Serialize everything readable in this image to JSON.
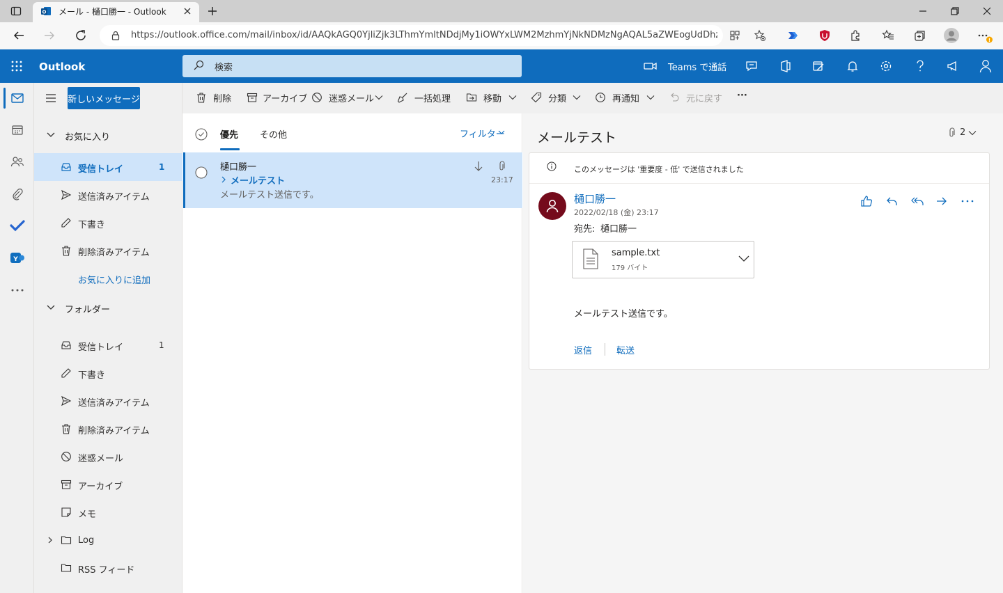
{
  "browser": {
    "tab_title": "メール - 樋口勝一 - Outlook",
    "url": "https://outlook.office.com/mail/inbox/id/AAQkAGQ0YjliZjk3LThmYmltNDdjMy1iOWYxLWM2MzhmYjNkNDMzNgAQAL5aZWEogUdDhz..."
  },
  "suite": {
    "app_name": "Outlook",
    "search_placeholder": "検索",
    "teams_call": "Teams で通話"
  },
  "new_message": "新しいメッセージ",
  "toolbar": {
    "delete": "削除",
    "archive": "アーカイブ",
    "junk": "迷惑メール",
    "sweep": "一括処理",
    "move": "移動",
    "categorize": "分類",
    "snooze": "再通知",
    "undo": "元に戻す",
    "more": "···"
  },
  "nav": {
    "favorites_header": "お気に入り",
    "favorites": [
      {
        "label": "受信トレイ",
        "count": "1"
      },
      {
        "label": "送信済みアイテム",
        "count": ""
      },
      {
        "label": "下書き",
        "count": ""
      },
      {
        "label": "削除済みアイテム",
        "count": ""
      }
    ],
    "add_favorite": "お気に入りに追加",
    "folders_header": "フォルダー",
    "folders": [
      {
        "label": "受信トレイ",
        "count": "1"
      },
      {
        "label": "下書き",
        "count": ""
      },
      {
        "label": "送信済みアイテム",
        "count": ""
      },
      {
        "label": "削除済みアイテム",
        "count": ""
      },
      {
        "label": "迷惑メール",
        "count": ""
      },
      {
        "label": "アーカイブ",
        "count": ""
      },
      {
        "label": "メモ",
        "count": ""
      },
      {
        "label": "Log",
        "count": ""
      },
      {
        "label": "RSS フィード",
        "count": ""
      }
    ]
  },
  "list": {
    "tab_focused": "優先",
    "tab_other": "その他",
    "filter": "フィルター",
    "messages": [
      {
        "sender": "樋口勝一",
        "subject": "メールテスト",
        "preview": "メールテスト送信です。",
        "time": "23:17"
      }
    ]
  },
  "reading": {
    "subject": "メールテスト",
    "attachment_count": "2",
    "importance_notice": "このメッセージは '重要度 - 低' で送信されました",
    "sender": "樋口勝一",
    "datetime": "2022/02/18 (金) 23:17",
    "to_label": "宛先:",
    "to": "樋口勝一",
    "attachment": {
      "name": "sample.txt",
      "size": "179 バイト"
    },
    "body": "メールテスト送信です。",
    "reply": "返信",
    "forward": "転送"
  },
  "colors": {
    "accent": "#0f6cbd",
    "selected": "#cfe4fa",
    "avatar": "#750b1c"
  }
}
